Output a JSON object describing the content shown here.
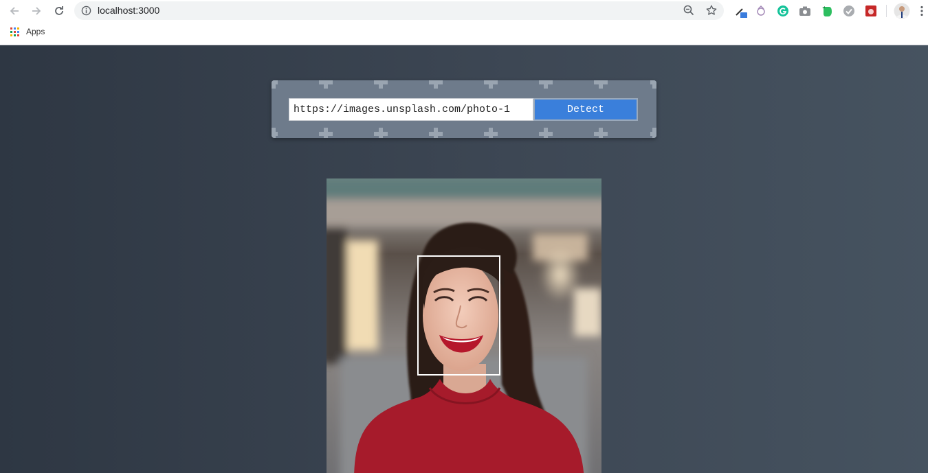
{
  "browser": {
    "url": "localhost:3000",
    "bookmarks_bar": {
      "apps_label": "Apps"
    },
    "icons": {
      "back": "arrow-left-icon",
      "forward": "arrow-right-icon",
      "reload": "reload-icon",
      "info": "info-icon",
      "zoom": "zoom-out-icon",
      "bookmark": "star-icon",
      "menu": "kebab-menu-icon"
    },
    "extensions": [
      "eyedropper-extension-icon",
      "spy-extension-icon",
      "grammarly-extension-icon",
      "camera-extension-icon",
      "evernote-extension-icon",
      "check-extension-icon",
      "red-extension-icon",
      "profile-avatar"
    ]
  },
  "app": {
    "form": {
      "image_url_value": "https://images.unsplash.com/photo-1",
      "detect_label": "Detect"
    },
    "colors": {
      "button": "#3a7fdb",
      "card": "#6e7b8b",
      "face_box": "#ffffff"
    }
  }
}
